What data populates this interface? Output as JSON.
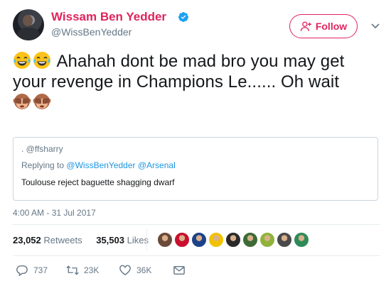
{
  "author": {
    "display_name": "Wissam Ben Yedder",
    "handle": "@WissBenYedder",
    "name_color": "#e0245e"
  },
  "follow_button": {
    "label": "Follow"
  },
  "tweet": {
    "line1": "Ahahah dont be mad bro you may get",
    "line2": "your revenge in Champions Le...... Oh wait",
    "leading_emojis": [
      "face-with-tears-of-joy",
      "face-with-tears-of-joy"
    ],
    "trailing_emojis": [
      "see-no-evil-monkey",
      "see-no-evil-monkey"
    ]
  },
  "quoted_tweet": {
    "handle": ". @ffsharry",
    "replying_prefix": "Replying to",
    "mention_1": "@WissBenYedder",
    "mention_2": "@Arsenal",
    "text": "Toulouse reject baguette shagging dwarf"
  },
  "timestamp": "4:00 AM - 31 Jul 2017",
  "stats": {
    "retweets_count": "23,052",
    "retweets_label": "Retweets",
    "likes_count": "35,503",
    "likes_label": "Likes"
  },
  "liker_avatars": [
    "#6b4a3a",
    "#c8102e",
    "#1d428a",
    "#f2c200",
    "#2a2a2a",
    "#3d6b35",
    "#8fb339",
    "#4a4a4a",
    "#2e8b57"
  ],
  "actions": {
    "reply_count": "737",
    "retweet_count": "23K",
    "like_count": "36K"
  },
  "colors": {
    "accent": "#e0245e",
    "link": "#1b95e0",
    "muted": "#657786",
    "verified": "#1da1f2"
  }
}
